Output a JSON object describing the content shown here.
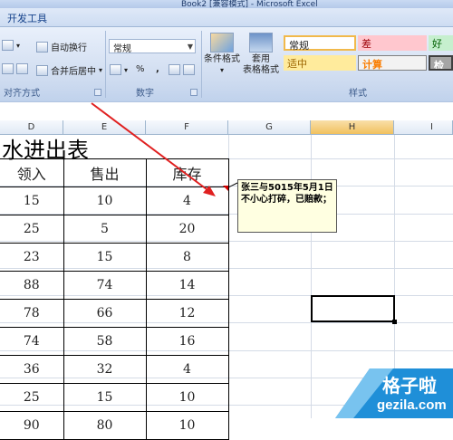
{
  "window": {
    "title": "Book2 [兼容模式] - Microsoft Excel"
  },
  "ribbon": {
    "tab": "开发工具",
    "alignment": {
      "wrap_text": "自动换行",
      "merge_center": "合并后居中",
      "label": "对齐方式"
    },
    "number": {
      "format_value": "常规",
      "percent": "%",
      "comma": ",",
      "label": "数字"
    },
    "styles": {
      "conditional_format": "条件格式",
      "format_as_table_1": "套用",
      "format_as_table_2": "表格格式",
      "cells": [
        "常规",
        "差",
        "好",
        "适中",
        "计算",
        "检查"
      ],
      "label": "样式"
    }
  },
  "sheet": {
    "columns": [
      "D",
      "E",
      "F",
      "G",
      "H",
      "I"
    ],
    "selected_column": "H",
    "title": "水进出表",
    "table": {
      "headers": [
        "领入",
        "售出",
        "库存"
      ],
      "rows": [
        [
          "15",
          "10",
          "4"
        ],
        [
          "25",
          "5",
          "20"
        ],
        [
          "23",
          "15",
          "8"
        ],
        [
          "88",
          "74",
          "14"
        ],
        [
          "78",
          "66",
          "12"
        ],
        [
          "74",
          "58",
          "16"
        ],
        [
          "36",
          "32",
          "4"
        ],
        [
          "25",
          "15",
          "10"
        ],
        [
          "90",
          "80",
          "10"
        ]
      ]
    },
    "comment": "张三与5015年5月1日不小心打碎，已赔款；"
  },
  "watermark": {
    "line1": "格子啦",
    "line2": "gezila.com"
  },
  "colors": {
    "comment_bg": "#ffffe1",
    "arrow": "#e02020",
    "bad": "#ffc7ce",
    "good": "#c6efce",
    "neutral": "#ffeb9c"
  }
}
